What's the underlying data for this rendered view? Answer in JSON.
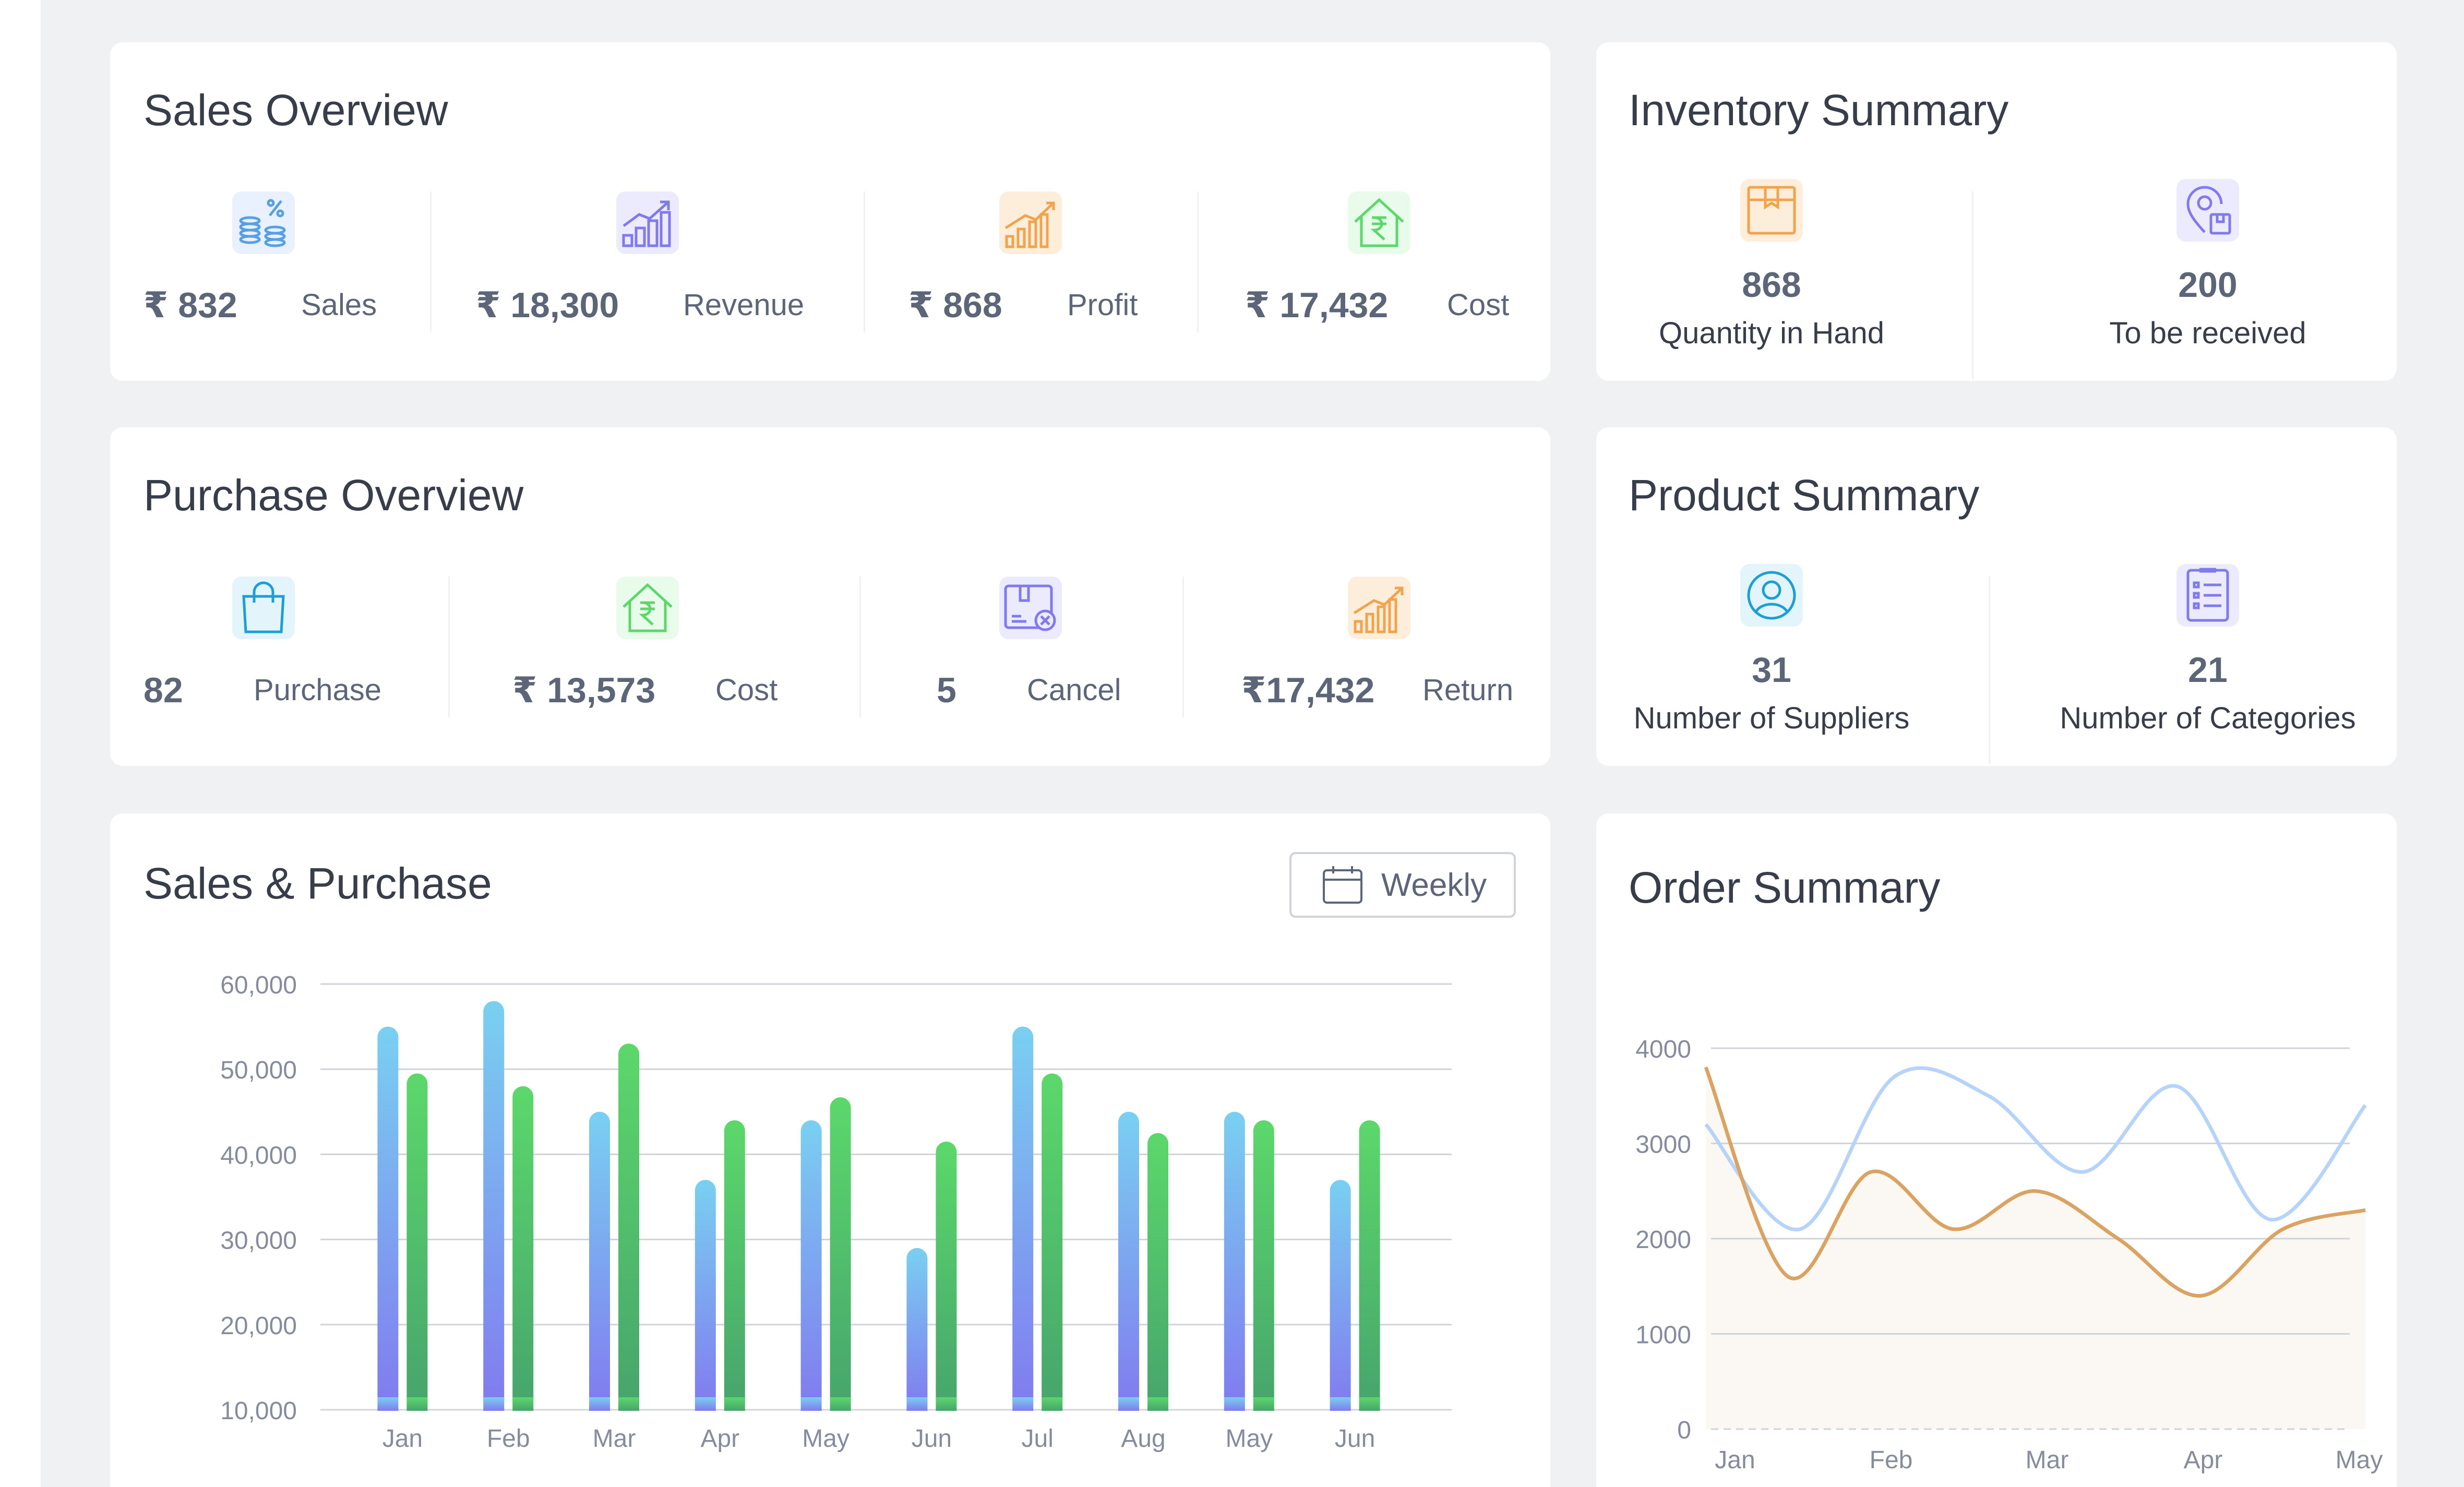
{
  "sales_overview": {
    "title": "Sales Overview",
    "items": [
      {
        "value": "₹ 832",
        "label": "Sales",
        "icon": "coins-percent-icon",
        "color": "#58a0e6"
      },
      {
        "value": "₹ 18,300",
        "label": "Revenue",
        "icon": "bar-chart-growth-icon",
        "color": "#817aef"
      },
      {
        "value": "₹ 868",
        "label": "Profit",
        "icon": "profit-chart-icon",
        "color": "#f2a44c"
      },
      {
        "value": "₹ 17,432",
        "label": "Cost",
        "icon": "house-rupee-icon",
        "color": "#5cd86b"
      }
    ]
  },
  "inventory_summary": {
    "title": "Inventory Summary",
    "items": [
      {
        "value": "868",
        "label": "Quantity in Hand",
        "icon": "box-icon",
        "color": "#f2a44c"
      },
      {
        "value": "200",
        "label": "To be received",
        "icon": "location-box-icon",
        "color": "#817aef"
      }
    ]
  },
  "purchase_overview": {
    "title": "Purchase Overview",
    "items": [
      {
        "value": "82",
        "label": "Purchase",
        "icon": "shopping-bag-icon",
        "color": "#1b9fd6"
      },
      {
        "value": "₹ 13,573",
        "label": "Cost",
        "icon": "house-rupee-icon",
        "color": "#5cd86b"
      },
      {
        "value": "5",
        "label": "Cancel",
        "icon": "cancel-delivery-icon",
        "color": "#817aef"
      },
      {
        "value": "₹17,432",
        "label": "Return",
        "icon": "profit-chart-icon",
        "color": "#f2a44c"
      }
    ]
  },
  "product_summary": {
    "title": "Product Summary",
    "items": [
      {
        "value": "31",
        "label": "Number of Suppliers",
        "icon": "user-circle-icon",
        "color": "#1b9fd6"
      },
      {
        "value": "21",
        "label": "Number of Categories",
        "icon": "list-document-icon",
        "color": "#817aef"
      }
    ]
  },
  "sales_purchase": {
    "title": "Sales & Purchase",
    "filter_label": "Weekly",
    "filter_icon": "calendar-icon"
  },
  "order_summary": {
    "title": "Order Summary"
  },
  "chart_data": [
    {
      "type": "bar",
      "categories": [
        "Jan",
        "Feb",
        "Mar",
        "Apr",
        "May",
        "Jun",
        "Jul",
        "Aug",
        "May",
        "Jun"
      ],
      "series": [
        {
          "values": [
            55000,
            58000,
            45000,
            37000,
            44000,
            29000,
            55000,
            45000,
            45000,
            37000
          ],
          "color_top": "#79d0f1",
          "color_bottom": "#817aef"
        },
        {
          "values": [
            49500,
            48000,
            53000,
            44000,
            46700,
            41500,
            49500,
            42500,
            44000,
            44000
          ],
          "color_top": "#5cd86b",
          "color_bottom": "#46a46c"
        }
      ],
      "yticks": [
        "60,000",
        "50,000",
        "40,000",
        "30,000",
        "20,000",
        "10,000"
      ],
      "ylim": [
        10000,
        60000
      ],
      "grid": true
    },
    {
      "type": "line",
      "x": [
        "Jan",
        "Feb",
        "Mar",
        "Apr",
        "May"
      ],
      "series": [
        {
          "values": [
            3200,
            2100,
            3700,
            3500,
            2700,
            3600,
            2200,
            3400
          ],
          "color": "#b6d3fa"
        },
        {
          "values": [
            3800,
            1600,
            2700,
            2100,
            2500,
            2000,
            1400,
            2100,
            2300
          ],
          "color": "#dba362",
          "fill": "#fbf7f2"
        }
      ],
      "yticks": [
        "4000",
        "3000",
        "2000",
        "1000",
        "0"
      ],
      "ylim": [
        0,
        4000
      ],
      "grid": true
    }
  ]
}
